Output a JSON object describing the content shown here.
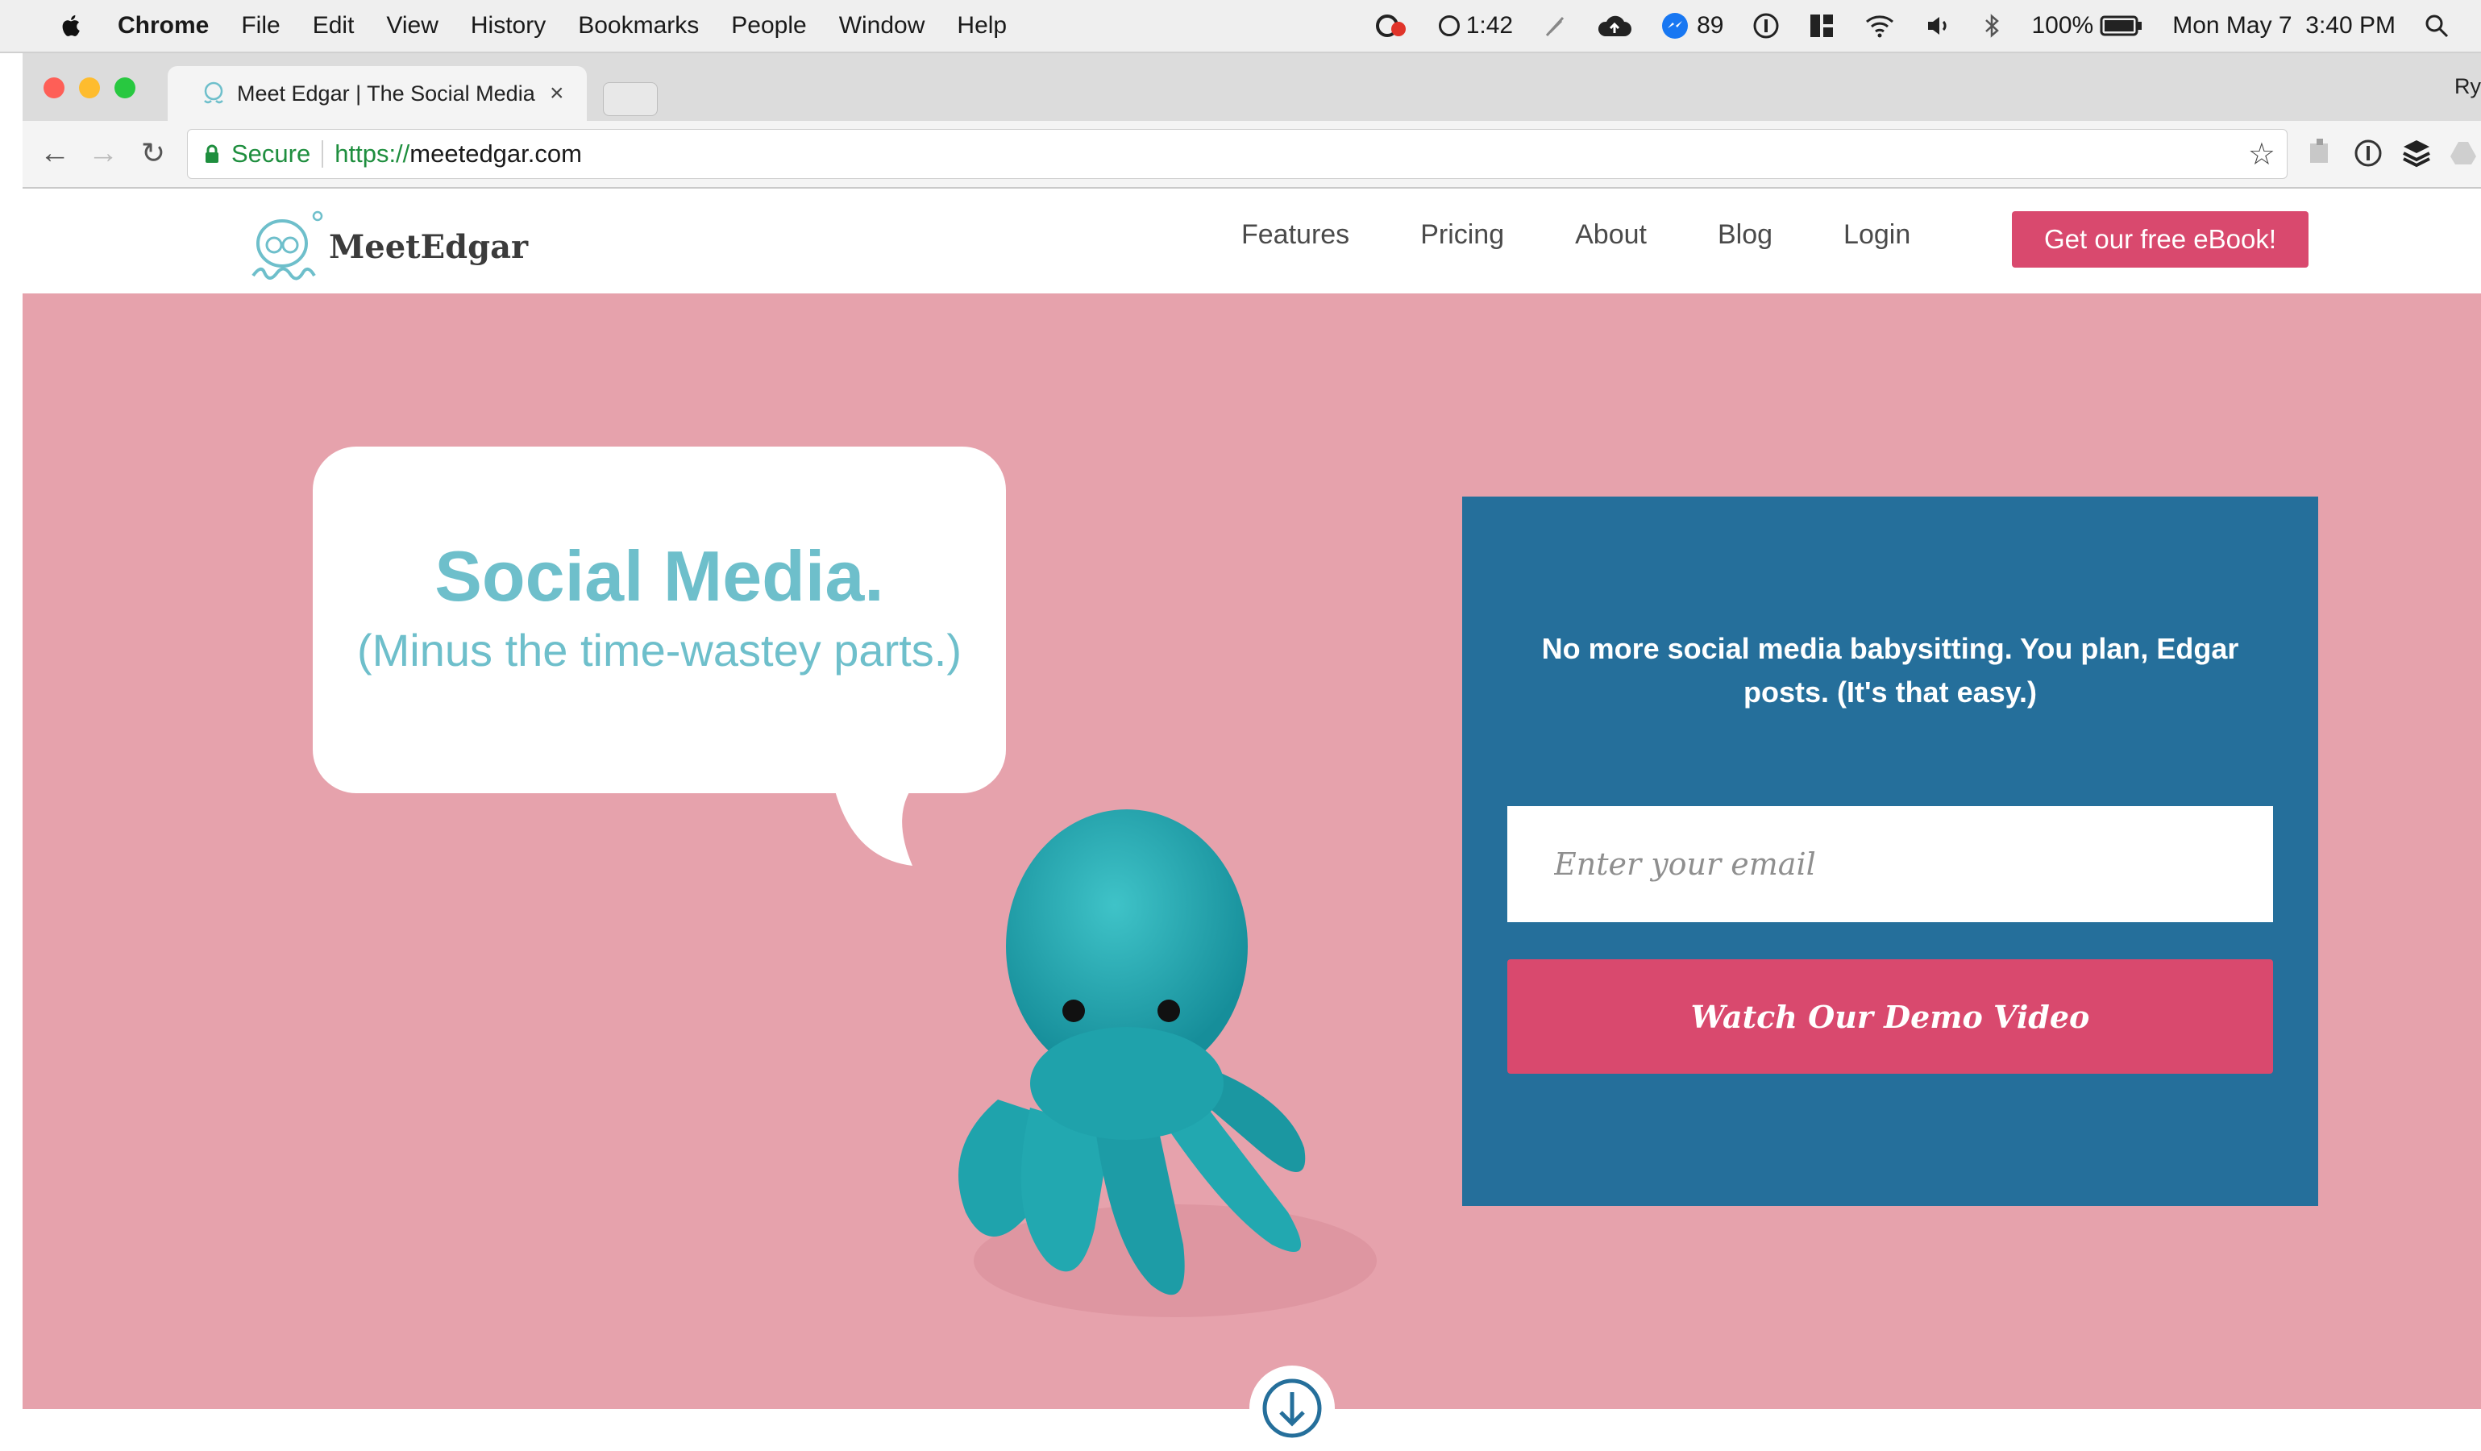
{
  "menubar": {
    "app_name": "Chrome",
    "items": [
      "File",
      "Edit",
      "View",
      "History",
      "Bookmarks",
      "People",
      "Window",
      "Help"
    ],
    "timer": "1:42",
    "badge_count": "89",
    "battery": "100%",
    "datetime": "Mon May 7  3:40 PM"
  },
  "browser": {
    "tab_title": "Meet Edgar | The Social Media",
    "tab_close": "×",
    "profile_partial": "Ry",
    "secure_label": "Secure",
    "url_scheme": "https://",
    "url_host": "meetedgar.com"
  },
  "site": {
    "logo_text": "MeetEdgar",
    "nav": [
      "Features",
      "Pricing",
      "About",
      "Blog",
      "Login"
    ],
    "ebook_cta": "Get our free eBook!",
    "headline": "Social Media.",
    "subheadline": "(Minus the time-wastey parts.)",
    "panel_text": "No more social media babysitting. You plan, Edgar posts. (It's that easy.)",
    "email_placeholder": "Enter your email",
    "demo_button": "Watch Our Demo Video"
  },
  "colors": {
    "hero_bg": "#e6a2ac",
    "panel_bg": "#256f9b",
    "accent_pink": "#d9496e",
    "teal": "#6ebfcb"
  },
  "icons": [
    "apple-icon",
    "creative-cloud-icon",
    "timer-icon",
    "cloud-upload-icon",
    "messenger-icon",
    "info-icon",
    "grid-icon",
    "wifi-icon",
    "volume-icon",
    "bluetooth-icon",
    "battery-icon",
    "search-icon",
    "back-icon",
    "forward-icon",
    "reload-icon",
    "lock-icon",
    "star-icon",
    "scroll-down-icon"
  ]
}
